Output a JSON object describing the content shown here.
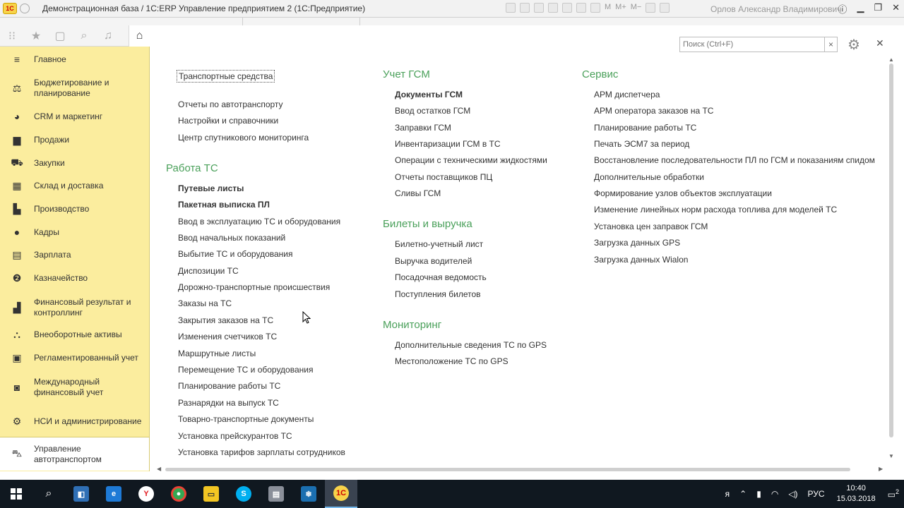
{
  "titlebar": {
    "logo": "1С",
    "title": "Демонстрационная база / 1С:ERP Управление предприятием 2  (1С:Предприятие)",
    "tools": [
      "M",
      "M+",
      "M−"
    ],
    "user": "Орлов Александр Владимирович"
  },
  "sidebar": {
    "items": [
      {
        "label": "Главное",
        "icon": "menu-icon"
      },
      {
        "label": "Бюджетирование и планирование",
        "icon": "budget-icon"
      },
      {
        "label": "CRM и маркетинг",
        "icon": "crm-icon"
      },
      {
        "label": "Продажи",
        "icon": "sales-icon"
      },
      {
        "label": "Закупки",
        "icon": "cart-icon"
      },
      {
        "label": "Склад и доставка",
        "icon": "warehouse-icon"
      },
      {
        "label": "Производство",
        "icon": "factory-icon"
      },
      {
        "label": "Кадры",
        "icon": "person-icon"
      },
      {
        "label": "Зарплата",
        "icon": "salary-icon"
      },
      {
        "label": "Казначейство",
        "icon": "treasury-icon"
      },
      {
        "label": "Финансовый результат и контроллинг",
        "icon": "chart-icon"
      },
      {
        "label": "Внеоборотные активы",
        "icon": "assets-icon"
      },
      {
        "label": "Регламентированный учет",
        "icon": "accounting-icon"
      },
      {
        "label": "Международный финансовый учет",
        "icon": "intl-icon"
      },
      {
        "label": "НСИ и администрирование",
        "icon": "gear-icon"
      },
      {
        "label": "Управление автотранспортом",
        "icon": "truck-icon"
      }
    ]
  },
  "search": {
    "placeholder": "Поиск (Ctrl+F)"
  },
  "col1": {
    "top_links": [
      "Транспортные средства",
      "Отчеты по автотранспорту",
      "Настройки и справочники",
      "Центр спутникового мониторинга"
    ],
    "section": "Работа ТС",
    "bold_links": [
      "Путевые листы",
      "Пакетная выписка ПЛ"
    ],
    "links": [
      "Ввод в эксплуатацию ТС и оборудования",
      "Ввод начальных показаний",
      "Выбытие ТС и оборудования",
      "Диспозиции ТС",
      "Дорожно-транспортные происшествия",
      "Заказы на ТС",
      "Закрытия заказов на ТС",
      "Изменения счетчиков ТС",
      "Маршрутные листы",
      "Перемещение ТС и оборудования",
      "Планирование работы ТС",
      "Разнарядки на выпуск ТС",
      "Товарно-транспортные документы",
      "Установка прейскурантов ТС",
      "Установка тарифов зарплаты сотрудников"
    ]
  },
  "col2": {
    "sections": [
      {
        "title": "Учет ГСМ",
        "bold": [
          "Документы ГСМ"
        ],
        "links": [
          "Ввод остатков ГСМ",
          "Заправки ГСМ",
          "Инвентаризации ГСМ в ТС",
          "Операции с техническими жидкостями",
          "Отчеты поставщиков ПЦ",
          "Сливы ГСМ"
        ]
      },
      {
        "title": "Билеты и выручка",
        "bold": [],
        "links": [
          "Билетно-учетный лист",
          "Выручка водителей",
          "Посадочная ведомость",
          "Поступления билетов"
        ]
      },
      {
        "title": "Мониторинг",
        "bold": [],
        "links": [
          "Дополнительные сведения ТС по GPS",
          "Местоположение ТС по GPS"
        ]
      }
    ]
  },
  "col3": {
    "section": "Сервис",
    "links": [
      "АРМ диспетчера",
      "АРМ оператора заказов на ТС",
      "Планирование работы ТС",
      "Печать ЭСМ7 за период",
      "Восстановление последовательности ПЛ по ГСМ и показаниям спидом",
      "Дополнительные обработки",
      "Формирование узлов объектов эксплуатации",
      "Изменение линейных норм расхода топлива для моделей ТС",
      "Установка цен заправок ГСМ",
      "Загрузка данных GPS",
      "Загрузка данных Wialon"
    ]
  },
  "taskbar": {
    "tray_lang": "РУС",
    "time": "10:40",
    "date": "15.03.2018",
    "notifications": "2"
  }
}
